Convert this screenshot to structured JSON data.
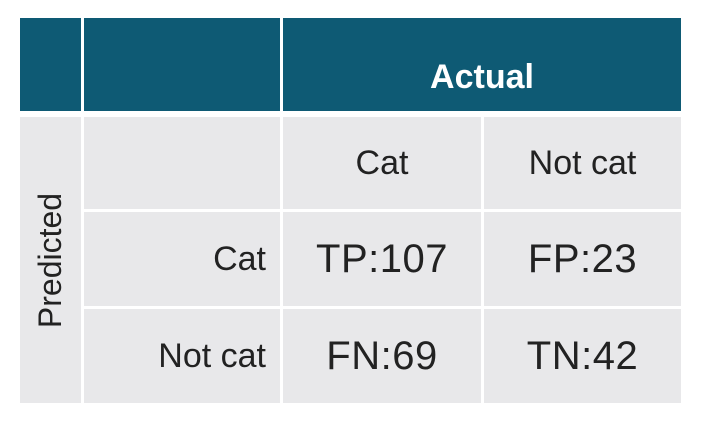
{
  "matrix": {
    "actual_label": "Actual",
    "predicted_label": "Predicted",
    "col_headers": [
      "Cat",
      "Not cat"
    ],
    "row_headers": [
      "Cat",
      "Not cat"
    ],
    "cells": [
      [
        "TP:107",
        "FP:23"
      ],
      [
        "FN:69",
        "TN:42"
      ]
    ],
    "colors": {
      "header": "#0e5a74",
      "body": "#e8e8ea",
      "text": "#222222"
    }
  }
}
